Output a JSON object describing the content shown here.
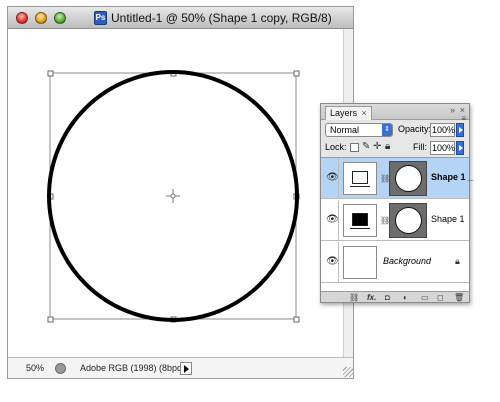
{
  "window": {
    "title": "Untitled-1 @ 50% (Shape 1 copy, RGB/8)",
    "doc_icon": "Ps"
  },
  "canvas": {
    "shape": "circle",
    "stroke_color": "#000000"
  },
  "status": {
    "zoom": "50%",
    "profile": "Adobe RGB (1998) (8bpc)"
  },
  "layers_panel": {
    "tab_label": "Layers",
    "tab_close": "×",
    "blend_mode": "Normal",
    "opacity_label": "Opacity:",
    "opacity_value": "100%",
    "lock_label": "Lock:",
    "fill_label": "Fill:",
    "fill_value": "100%",
    "layers": [
      {
        "name": "Shape 1 _",
        "selected": true
      },
      {
        "name": "Shape 1",
        "selected": false
      },
      {
        "name": "Background",
        "selected": false
      }
    ],
    "footer_fx": "fx."
  },
  "colors": {
    "selection": "#b5d3f5",
    "accent_blue": "#3a6fd8"
  }
}
